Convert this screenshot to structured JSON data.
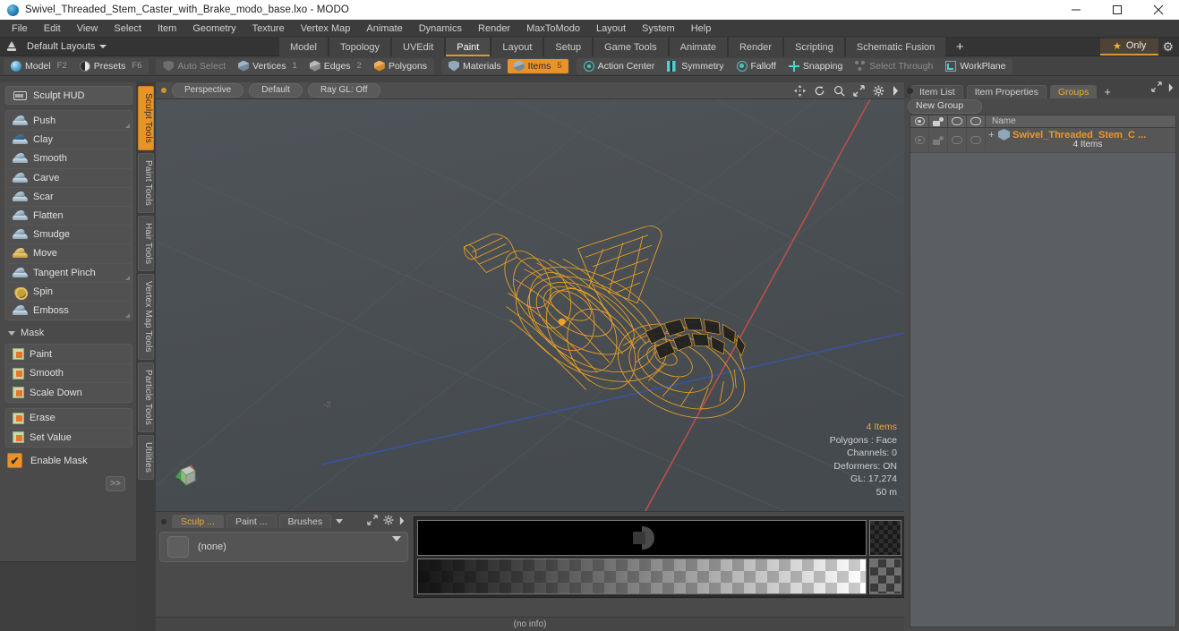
{
  "window": {
    "title": "Swivel_Threaded_Stem_Caster_with_Brake_modo_base.lxo - MODO",
    "app_icon": "modo-sphere-icon",
    "minimize": "minimize-icon",
    "maximize": "maximize-icon",
    "close": "close-icon"
  },
  "menubar": {
    "items": [
      "File",
      "Edit",
      "View",
      "Select",
      "Item",
      "Geometry",
      "Texture",
      "Vertex Map",
      "Animate",
      "Dynamics",
      "Render",
      "MaxToModo",
      "Layout",
      "System",
      "Help"
    ]
  },
  "layoutbar": {
    "export_icon": "export-icon",
    "layouts_label": "Default Layouts",
    "tabs": [
      {
        "label": "Model",
        "active": false
      },
      {
        "label": "Topology",
        "active": false
      },
      {
        "label": "UVEdit",
        "active": false
      },
      {
        "label": "Paint",
        "active": true
      },
      {
        "label": "Layout",
        "active": false
      },
      {
        "label": "Setup",
        "active": false
      },
      {
        "label": "Game Tools",
        "active": false
      },
      {
        "label": "Animate",
        "active": false
      },
      {
        "label": "Render",
        "active": false
      },
      {
        "label": "Scripting",
        "active": false
      },
      {
        "label": "Schematic Fusion",
        "active": false
      }
    ],
    "add_tab": "+",
    "only_label": "Only",
    "star_icon": "star-icon",
    "gear_icon": "gear-icon",
    "accent": "#d99a34"
  },
  "modebar": {
    "mode_group": [
      {
        "label": "Model",
        "shortcut": "F2",
        "icon": "sphere-icon",
        "state": "normal"
      },
      {
        "label": "Presets",
        "shortcut": "F6",
        "icon": "preset-icon",
        "state": "normal"
      }
    ],
    "select_group": [
      {
        "label": "Auto Select",
        "icon": "shield-icon",
        "count": "",
        "state": "dim"
      },
      {
        "label": "Vertices",
        "icon": "cube-icon",
        "count": "1",
        "state": "normal"
      },
      {
        "label": "Edges",
        "icon": "cube-icon",
        "count": "2",
        "state": "normal"
      },
      {
        "label": "Polygons",
        "icon": "cube-icon",
        "count": "",
        "state": "normal"
      },
      {
        "label": "Materials",
        "icon": "shield-icon",
        "count": "",
        "state": "normal"
      },
      {
        "label": "Items",
        "icon": "cube-icon",
        "count": "5",
        "state": "selected"
      }
    ],
    "action_group": [
      {
        "label": "Action Center",
        "icon": "target-icon",
        "state": "normal"
      },
      {
        "label": "Symmetry",
        "icon": "symmetry-icon",
        "state": "normal"
      },
      {
        "label": "Falloff",
        "icon": "falloff-icon",
        "state": "normal"
      },
      {
        "label": "Snapping",
        "icon": "snapping-icon",
        "state": "normal"
      },
      {
        "label": "Select Through",
        "icon": "select-through-icon",
        "state": "dim"
      },
      {
        "label": "WorkPlane",
        "icon": "workplane-icon",
        "state": "normal"
      }
    ]
  },
  "left_panel": {
    "hud_button": {
      "label": "Sculpt HUD",
      "icon": "hud-icon"
    },
    "sculpt_tools": [
      {
        "label": "Push",
        "icon": "brush-icon",
        "has_corner": true
      },
      {
        "label": "Clay",
        "icon": "brush-icon",
        "has_corner": false
      },
      {
        "label": "Smooth",
        "icon": "brush-icon",
        "has_corner": false
      },
      {
        "label": "Carve",
        "icon": "brush-icon",
        "has_corner": false
      },
      {
        "label": "Scar",
        "icon": "brush-icon",
        "has_corner": false
      },
      {
        "label": "Flatten",
        "icon": "brush-icon",
        "has_corner": false
      },
      {
        "label": "Smudge",
        "icon": "brush-icon",
        "has_corner": false
      },
      {
        "label": "Move",
        "icon": "brush-move-icon",
        "has_corner": false
      },
      {
        "label": "Tangent Pinch",
        "icon": "brush-icon",
        "has_corner": true
      },
      {
        "label": "Spin",
        "icon": "brush-spin-icon",
        "has_corner": false
      },
      {
        "label": "Emboss",
        "icon": "brush-icon",
        "has_corner": true
      }
    ],
    "mask_section_label": "Mask",
    "mask_tools": [
      {
        "label": "Paint",
        "icon": "mask-swatch-icon"
      },
      {
        "label": "Smooth",
        "icon": "mask-swatch-icon"
      },
      {
        "label": "Scale Down",
        "icon": "mask-swatch-icon"
      }
    ],
    "mask_tools2": [
      {
        "label": "Erase",
        "icon": "mask-swatch-icon"
      },
      {
        "label": "Set Value",
        "icon": "mask-swatch-icon"
      }
    ],
    "enable_mask": {
      "label": "Enable Mask",
      "checked": true,
      "check_icon": "checkmark-icon"
    },
    "expand_button": ">>"
  },
  "vertical_tabs": [
    {
      "label": "Sculpt Tools",
      "active": true
    },
    {
      "label": "Paint Tools",
      "active": false
    },
    {
      "label": "Hair Tools",
      "active": false
    },
    {
      "label": "Vertex Map Tools",
      "active": false
    },
    {
      "label": "Particle Tools",
      "active": false
    },
    {
      "label": "Utilities",
      "active": false
    }
  ],
  "viewport": {
    "header": {
      "dot": "viewport-indicator",
      "pills": [
        "Perspective",
        "Default",
        "Ray GL: Off"
      ],
      "tools": [
        "pan-icon",
        "rotate-icon",
        "zoom-icon",
        "fit-icon",
        "gear-icon",
        "chevron-right-icon"
      ]
    },
    "grid_label": "-2",
    "axis_gizmo": "axis-gizmo-icon",
    "model": "orange-wireframe-caster",
    "info": [
      {
        "text": "4 Items",
        "highlight": true
      },
      {
        "text": "Polygons : Face",
        "highlight": false
      },
      {
        "text": "Channels: 0",
        "highlight": false
      },
      {
        "text": "Deformers: ON",
        "highlight": false
      },
      {
        "text": "GL: 17,274",
        "highlight": false
      },
      {
        "text": "50 m",
        "highlight": false
      }
    ],
    "colors": {
      "background": "#4a4f53",
      "model": "#f5a623",
      "x_axis": "#c0504d",
      "z_axis": "#3a53a4"
    }
  },
  "bottom_dock": {
    "tabs": [
      {
        "label": "Sculp ...",
        "active": true
      },
      {
        "label": "Paint ...",
        "active": false
      },
      {
        "label": "Brushes",
        "active": false
      }
    ],
    "tab_caret": "chevron-down-icon",
    "tools": [
      "expand-icon",
      "gear-icon",
      "chevron-right-icon"
    ],
    "preset_field": {
      "value": "(none)",
      "swatch": "preset-swatch",
      "caret": "chevron-down-icon"
    },
    "status": "(no info)"
  },
  "right_panel": {
    "tabs": [
      {
        "label": "Item List",
        "active": false
      },
      {
        "label": "Item Properties",
        "active": false
      },
      {
        "label": "Groups",
        "active": true
      }
    ],
    "add_tab": "+",
    "tools": [
      "expand-icon",
      "chevron-right-icon"
    ],
    "new_group_button": "New Group",
    "columns": [
      {
        "icon": "eye-icon",
        "label": ""
      },
      {
        "icon": "render-icon",
        "label": ""
      },
      {
        "icon": "lock-pill-icon",
        "label": ""
      },
      {
        "icon": "lock-pill-icon",
        "label": ""
      },
      {
        "icon": "",
        "label": "Name"
      }
    ],
    "rows": [
      {
        "expand": "+",
        "icon": "group-icon",
        "name": "Swivel_Threaded_Stem_C ...",
        "subtitle": "4 Items",
        "name_color": "#e89a2a"
      }
    ]
  }
}
